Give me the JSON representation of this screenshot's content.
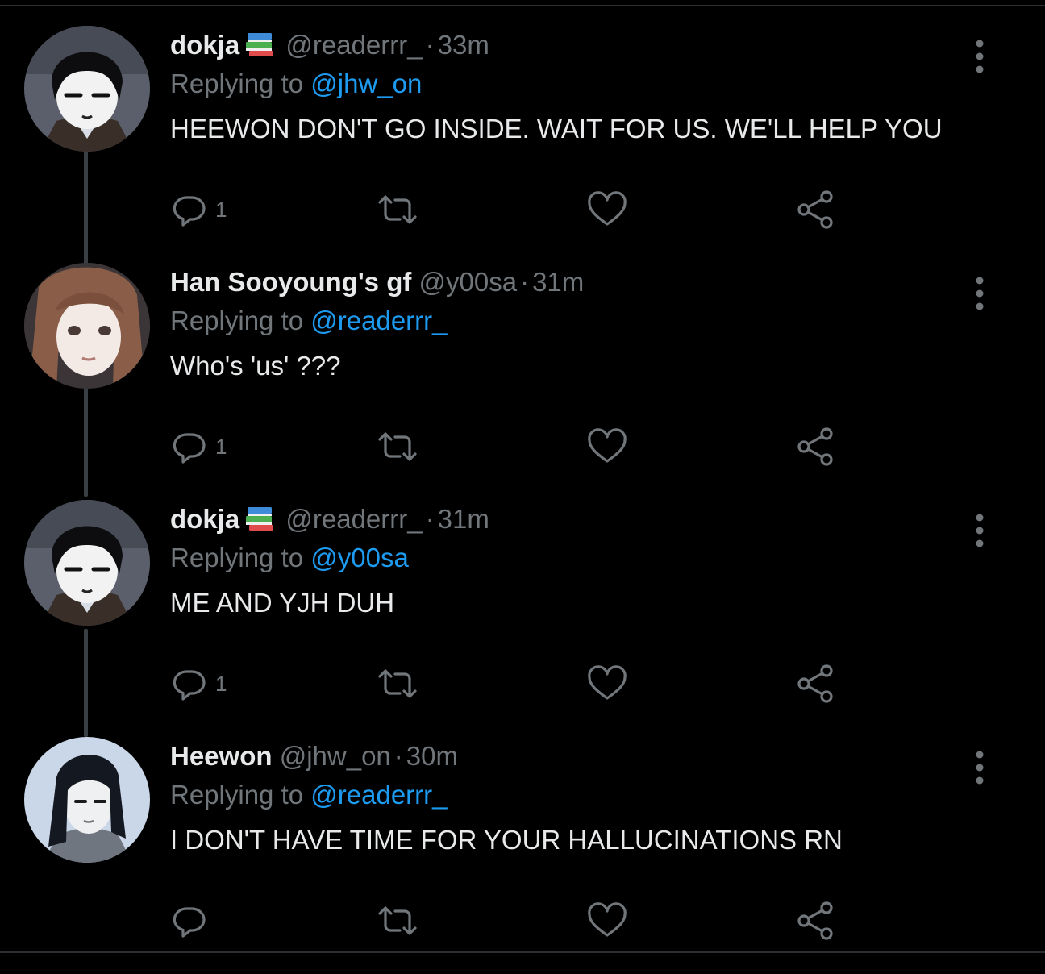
{
  "tweets": [
    {
      "name": "dokja",
      "emoji": "books-emoji",
      "handle": "@readerrr_",
      "separator": "·",
      "time": "33m",
      "replying_prefix": "Replying to",
      "replying_to": "@jhw_on",
      "text": "HEEWON DON'T GO INSIDE. WAIT FOR US. WE'LL HELP YOU",
      "reply_count": "1"
    },
    {
      "name": "Han Sooyoung's gf",
      "handle": "@y00sa",
      "separator": "·",
      "time": "31m",
      "replying_prefix": "Replying to",
      "replying_to": "@readerrr_",
      "text": "Who's 'us' ???",
      "reply_count": "1"
    },
    {
      "name": "dokja",
      "emoji": "books-emoji",
      "handle": "@readerrr_",
      "separator": "·",
      "time": "31m",
      "replying_prefix": "Replying to",
      "replying_to": "@y00sa",
      "text": "ME AND YJH DUH",
      "reply_count": "1"
    },
    {
      "name": "Heewon",
      "handle": "@jhw_on",
      "separator": "·",
      "time": "30m",
      "replying_prefix": "Replying to",
      "replying_to": "@readerrr_",
      "text": "I DON'T HAVE TIME FOR YOUR HALLUCINATIONS RN",
      "reply_count": ""
    }
  ],
  "colors": {
    "background": "#000000",
    "text_primary": "#e7e9ea",
    "text_secondary": "#71767b",
    "mention": "#1d9bf0",
    "thread_line": "#3a3f44"
  },
  "icons": [
    "reply-icon",
    "retweet-icon",
    "like-icon",
    "share-icon",
    "more-options-icon"
  ]
}
